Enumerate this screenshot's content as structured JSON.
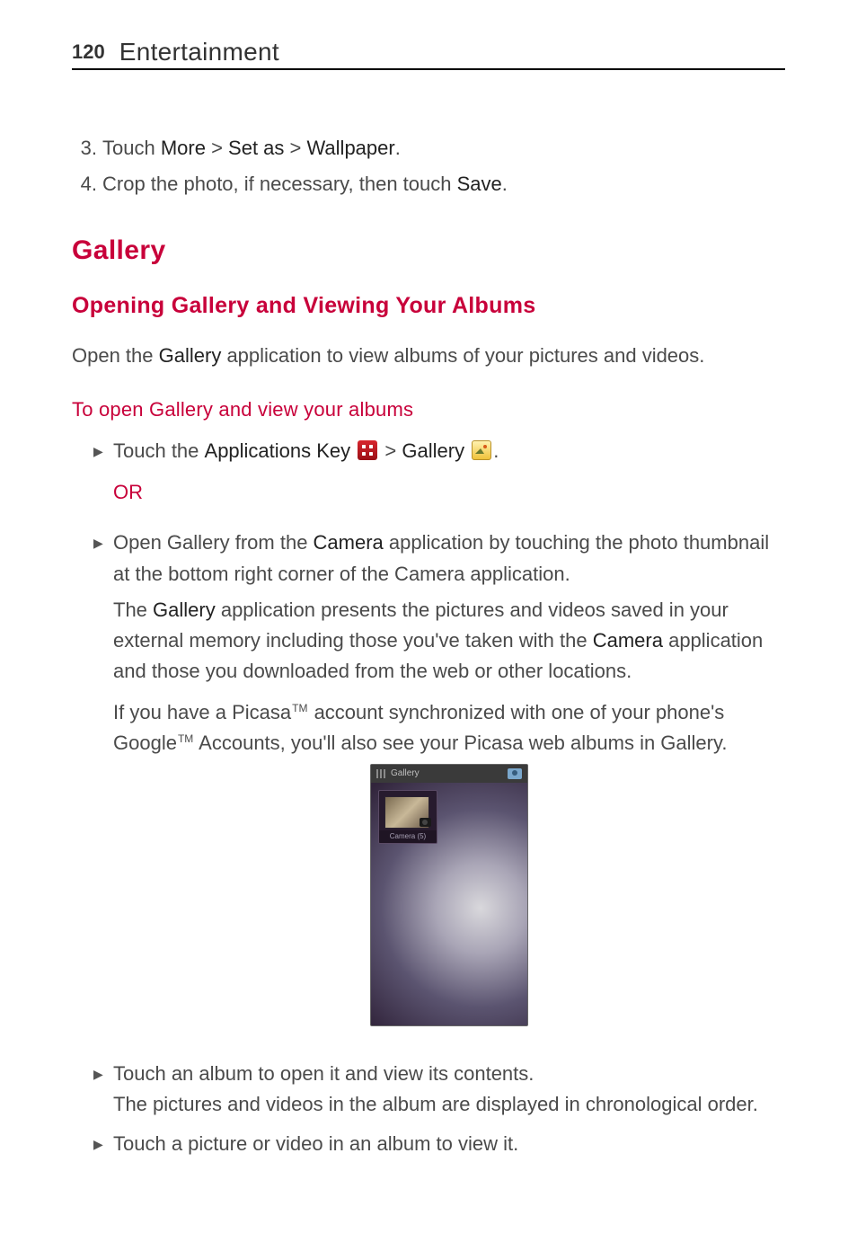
{
  "page_number": "120",
  "section_header": "Entertainment",
  "steps": {
    "three": {
      "num": "3.",
      "pre": "Touch ",
      "parts": [
        "More",
        " > ",
        "Set as",
        " > ",
        "Wallpaper",
        "."
      ]
    },
    "four": {
      "num": "4.",
      "pre": "Crop the photo, if necessary, then touch ",
      "bold": "Save",
      "post": "."
    }
  },
  "h1": "Gallery",
  "h2": "Opening Gallery and Viewing Your Albums",
  "intro": {
    "pre": "Open the ",
    "bold": "Gallery",
    "post": " application to view albums of your pictures and videos."
  },
  "h3": "To open Gallery and view your albums",
  "b1": {
    "pre": "Touch the ",
    "b1": "Applications Key",
    "mid1": " > ",
    "b2": "Gallery",
    "post": "."
  },
  "or": "OR",
  "b2": {
    "p1_pre": "Open Gallery from the ",
    "p1_b": "Camera",
    "p1_post": " application by touching the photo thumbnail at the bottom right corner of the Camera application.",
    "p2_pre": "The ",
    "p2_b1": "Gallery",
    "p2_mid": " application presents the pictures and videos saved in your external memory including those you've taken with the ",
    "p2_b2": "Camera",
    "p2_post": " application and those you downloaded from the web or other locations.",
    "p3_pre": "If you have a Picasa",
    "p3_tm1": "TM",
    "p3_mid": " account synchronized with one of your phone's Google",
    "p3_tm2": "TM",
    "p3_post": " Accounts, you'll also see your Picasa web albums in Gallery."
  },
  "screenshot": {
    "topbar_label": "Gallery",
    "album_label": "Camera (5)"
  },
  "b3": {
    "l1": "Touch an album to open it and view its contents.",
    "l2": "The pictures and videos in the album are displayed in chronological order."
  },
  "b4": "Touch a picture or video in an album to view it.",
  "icons": {
    "applications": "applications-key-icon",
    "gallery": "gallery-icon"
  },
  "accent_color": "#c8003a"
}
